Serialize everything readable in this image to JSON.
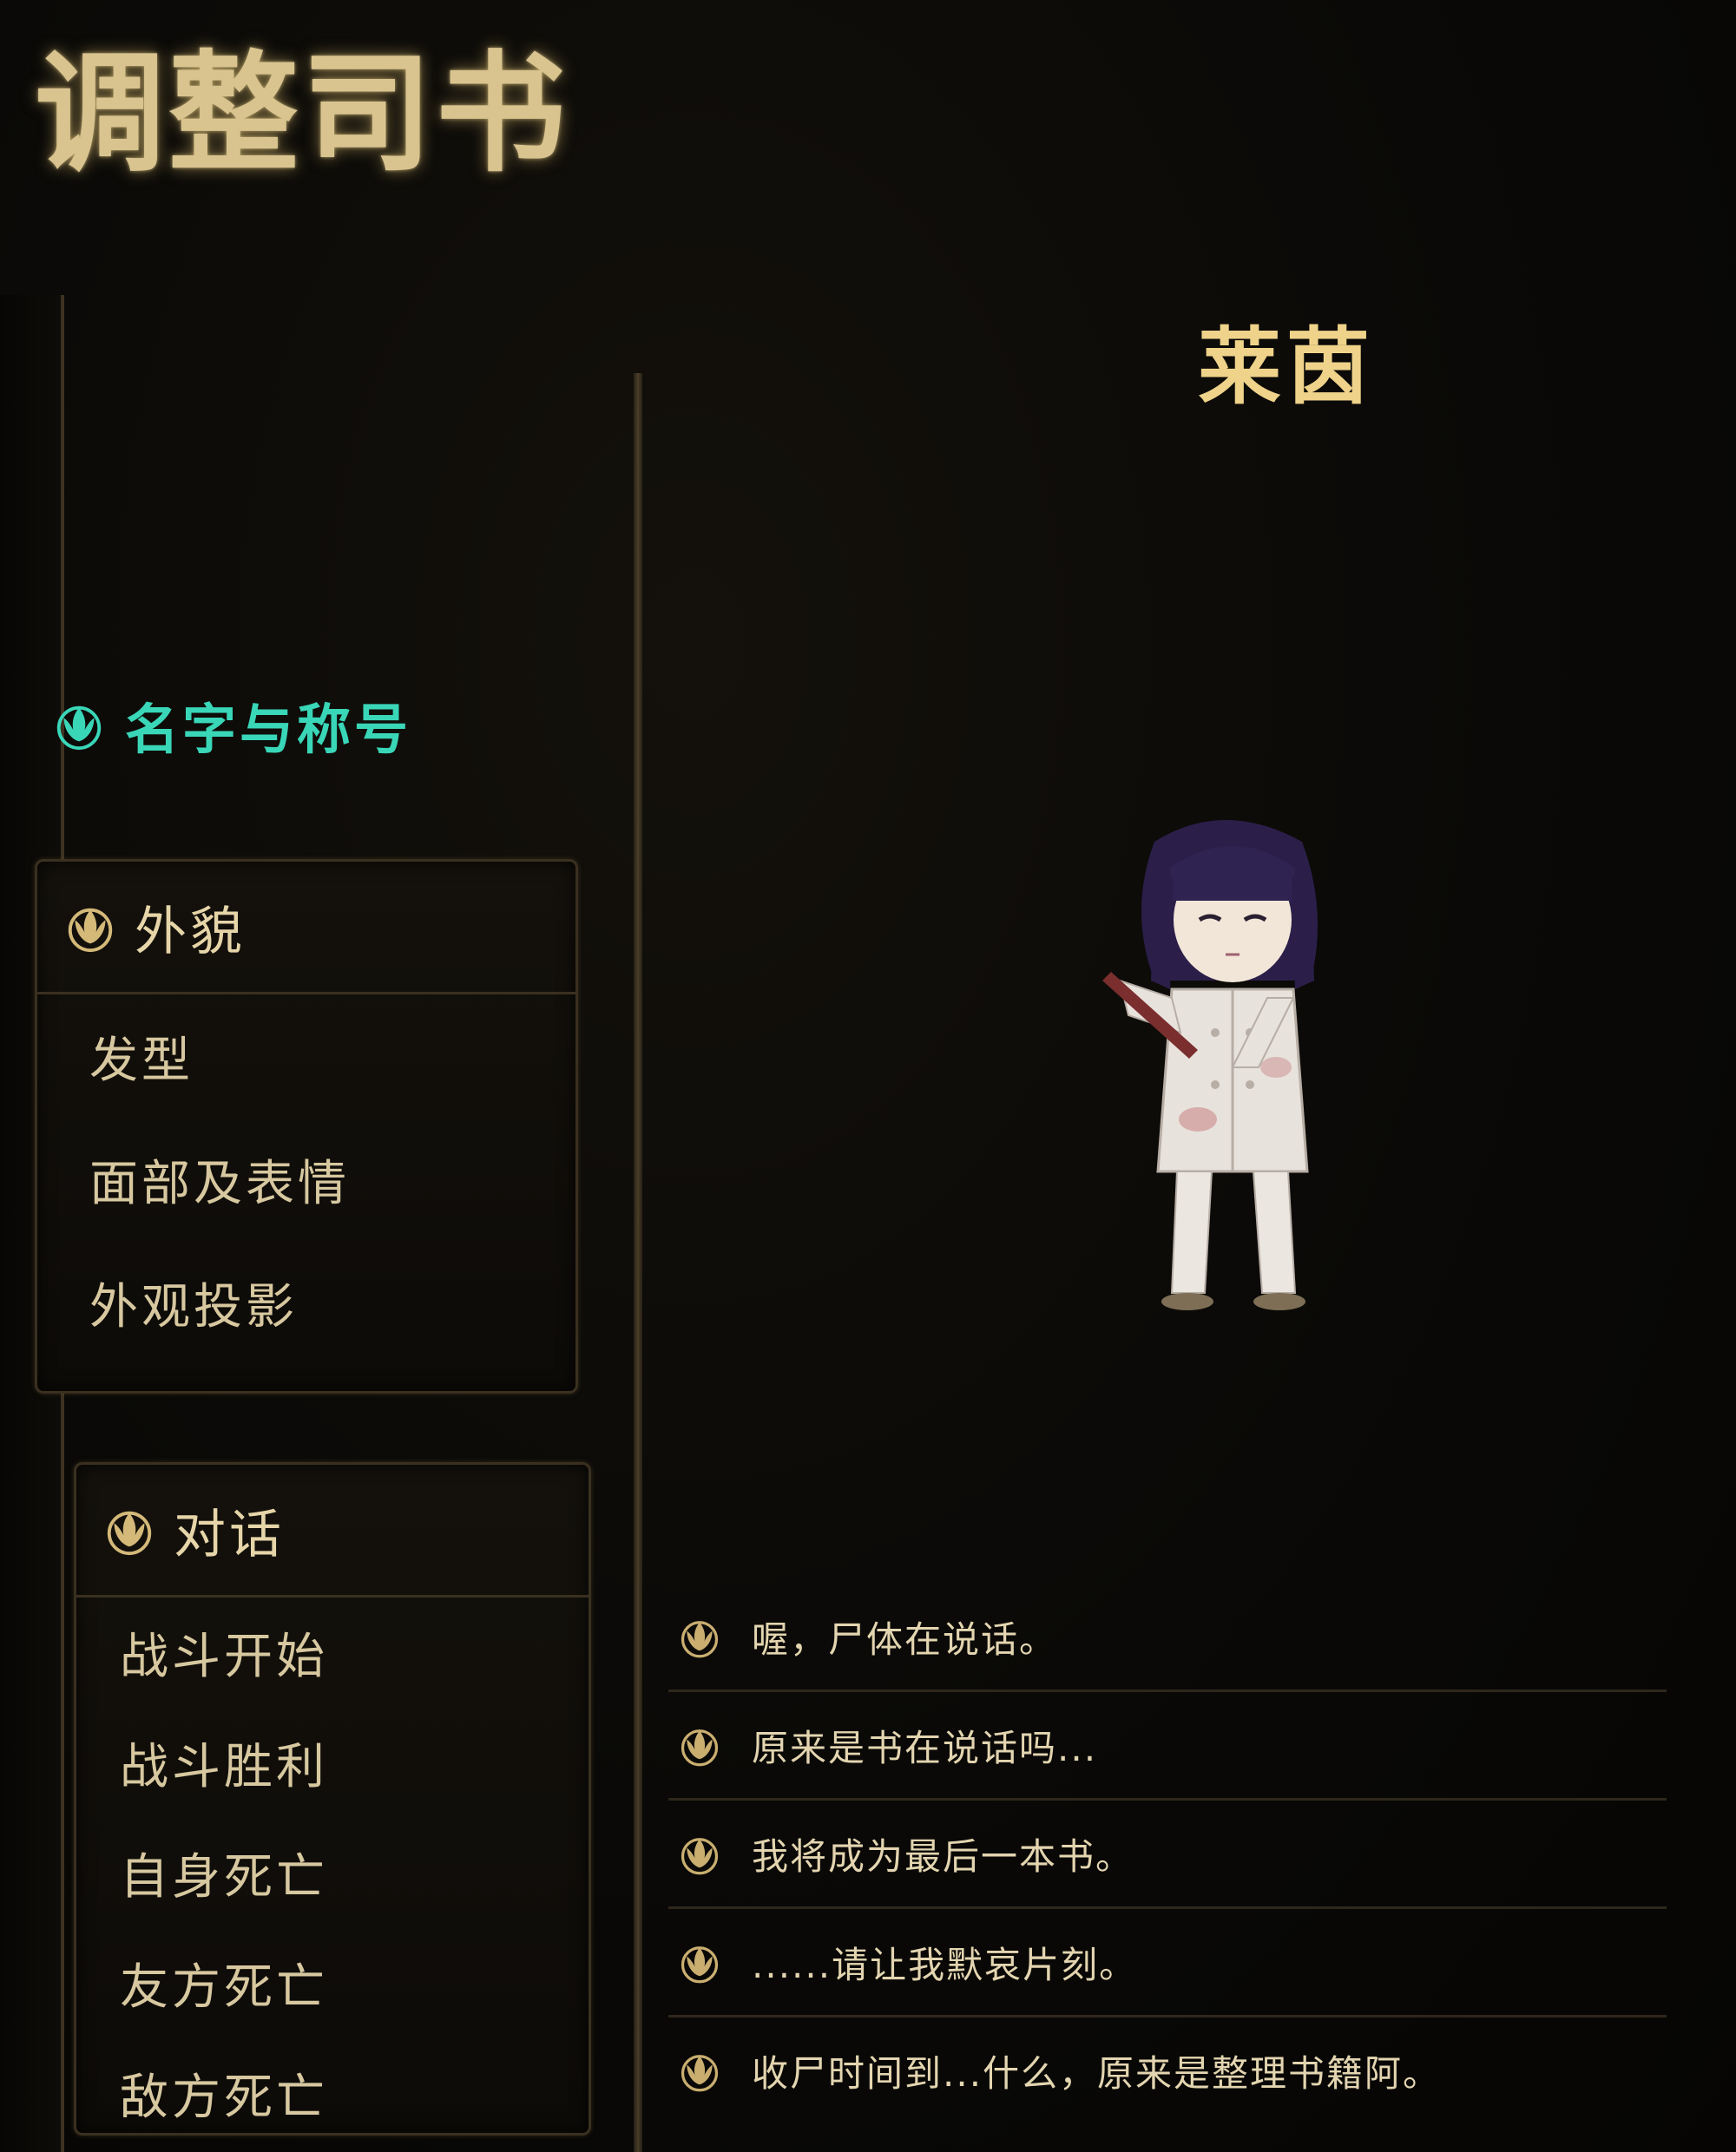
{
  "app_title": "调整司书",
  "character_name": "莱茵",
  "nav": {
    "active_label": "名字与称号",
    "appearance": {
      "header": "外貌",
      "items": [
        "发型",
        "面部及表情",
        "外观投影"
      ]
    },
    "dialogue": {
      "header": "对话",
      "items": [
        "战斗开始",
        "战斗胜利",
        "自身死亡",
        "友方死亡",
        "敌方死亡"
      ]
    }
  },
  "dialogue_lines": [
    "喔，尸体在说话。",
    "原来是书在说话吗...",
    "我将成为最后一本书。",
    "......请让我默哀片刻。",
    "收尸时间到...什么，原来是整理书籍阿。"
  ],
  "colors": {
    "gold": "#d9c490",
    "active_teal": "#39d6b8",
    "name_gold": "#efd38a"
  }
}
